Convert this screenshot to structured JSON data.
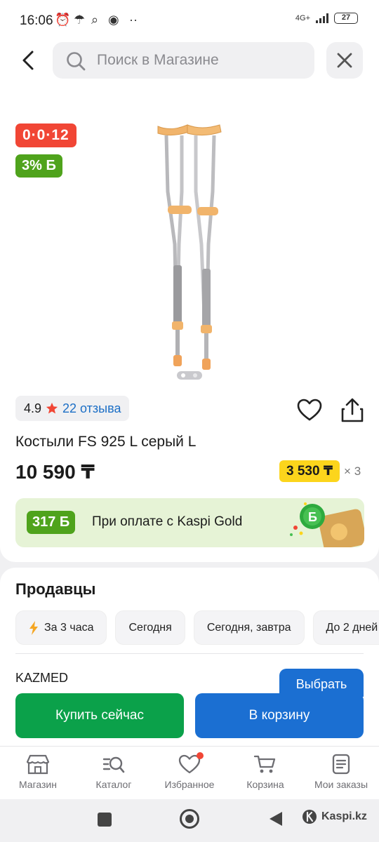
{
  "status_bar": {
    "time": "16:06",
    "network": "4G+",
    "battery": "27"
  },
  "header": {
    "search_placeholder": "Поиск в Магазине"
  },
  "product": {
    "timer": "0·0·12",
    "bonus_tag": "3% Б",
    "rating": "4.9",
    "reviews": "22 отзыва",
    "title": "Костыли FS 925 L серый L",
    "price": "10 590 ₸",
    "installment_amount": "3 530 ₸",
    "installment_times": "× 3",
    "gallery_count": 2,
    "gallery_index": 1
  },
  "gold_banner": {
    "bonus": "317 Б",
    "text": "При оплате с Kaspi Gold"
  },
  "sellers": {
    "heading": "Продавцы",
    "filters": [
      "За 3 часа",
      "Сегодня",
      "Сегодня, завтра",
      "До 2 дней"
    ],
    "first_seller": "KAZMED",
    "choose_label": "Выбрать"
  },
  "actions": {
    "buy_now": "Купить сейчас",
    "add_to_cart": "В корзину"
  },
  "bottom_nav": {
    "items": [
      {
        "label": "Магазин",
        "icon": "shop-icon"
      },
      {
        "label": "Каталог",
        "icon": "catalog-icon"
      },
      {
        "label": "Избранное",
        "icon": "heart-icon"
      },
      {
        "label": "Корзина",
        "icon": "cart-icon"
      },
      {
        "label": "Мои заказы",
        "icon": "orders-icon"
      }
    ]
  },
  "watermark": "Kaspi.kz",
  "colors": {
    "red": "#f14635",
    "green": "#4fa31c",
    "blue": "#1b6fd2",
    "buy_green": "#0ba14a",
    "yellow": "#fcd51c"
  }
}
